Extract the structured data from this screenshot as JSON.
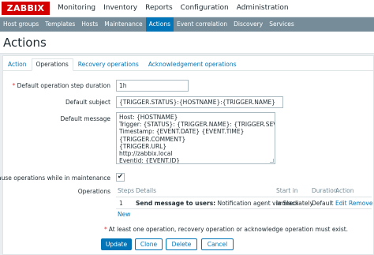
{
  "logo": "ZABBIX",
  "top_menu": [
    "Monitoring",
    "Inventory",
    "Reports",
    "Configuration",
    "Administration"
  ],
  "sub_menu": [
    "Host groups",
    "Templates",
    "Hosts",
    "Maintenance",
    "Actions",
    "Event correlation",
    "Discovery",
    "Services"
  ],
  "page_title": "Actions",
  "tabs": [
    "Action",
    "Operations",
    "Recovery operations",
    "Acknowledgement operations"
  ],
  "form": {
    "step_duration_label": "Default operation step duration",
    "step_duration_value": "1h",
    "subject_label": "Default subject",
    "subject_value": "{TRIGGER.STATUS}:{HOSTNAME}:{TRIGGER.NAME}",
    "message_label": "Default message",
    "message_lines": [
      "Host: {HOSTNAME}",
      "Trigger: {STATUS}: {TRIGGER.NAME}: {TRIGGER.SEVERITY}",
      "Timestamp: {EVENT.DATE} {EVENT.TIME}",
      "{TRIGGER.COMMENT}",
      "{TRIGGER.URL}",
      "http://zabbix.local",
      "Eventid: {EVENT.ID}"
    ],
    "pause_label": "Pause operations while in maintenance",
    "pause_checked": "✔",
    "operations_label": "Operations"
  },
  "operations_table": {
    "headers": [
      "Steps",
      "Details",
      "Start in",
      "Duration",
      "Action"
    ],
    "row": {
      "steps": "1",
      "details_bold": "Send message to users:",
      "details_rest": " Notification agent via Slack",
      "start_in": "Immediately",
      "duration": "Default",
      "edit": "Edit",
      "remove": "Remove"
    },
    "new_link": "New"
  },
  "note": "At least one operation, recovery operation or acknowledge operation must exist.",
  "buttons": [
    "Update",
    "Clone",
    "Delete",
    "Cancel"
  ]
}
